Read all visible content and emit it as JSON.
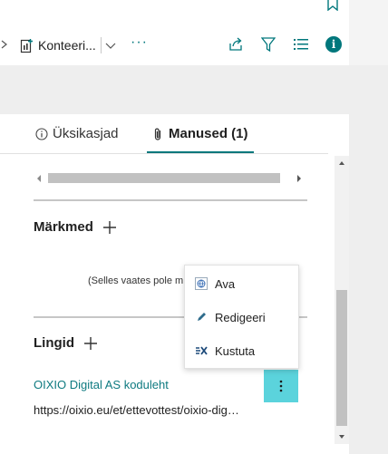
{
  "toolbar": {
    "konteeri_label": "Konteeri...",
    "more_label": "···"
  },
  "tabs": [
    {
      "label": "Üksikasjad",
      "icon": "info-circle-icon",
      "active": false
    },
    {
      "label": "Manused (1)",
      "icon": "paperclip-icon",
      "active": true
    }
  ],
  "notes": {
    "title": "Märkmed",
    "empty_text": "(Selles vaates pole m"
  },
  "links": {
    "title": "Lingid",
    "items": [
      {
        "title": "OIXIO Digital AS koduleht",
        "url": "https://oixio.eu/et/ettevottest/oixio-dig…"
      }
    ]
  },
  "context_menu": {
    "items": [
      {
        "label": "Ava",
        "icon": "globe-icon"
      },
      {
        "label": "Redigeeri",
        "icon": "pencil-icon"
      },
      {
        "label": "Kustuta",
        "icon": "delete-link-icon"
      }
    ]
  },
  "colors": {
    "accent": "#00777c",
    "link": "#0e7a80",
    "kebab_bg": "#5bd3dc"
  }
}
